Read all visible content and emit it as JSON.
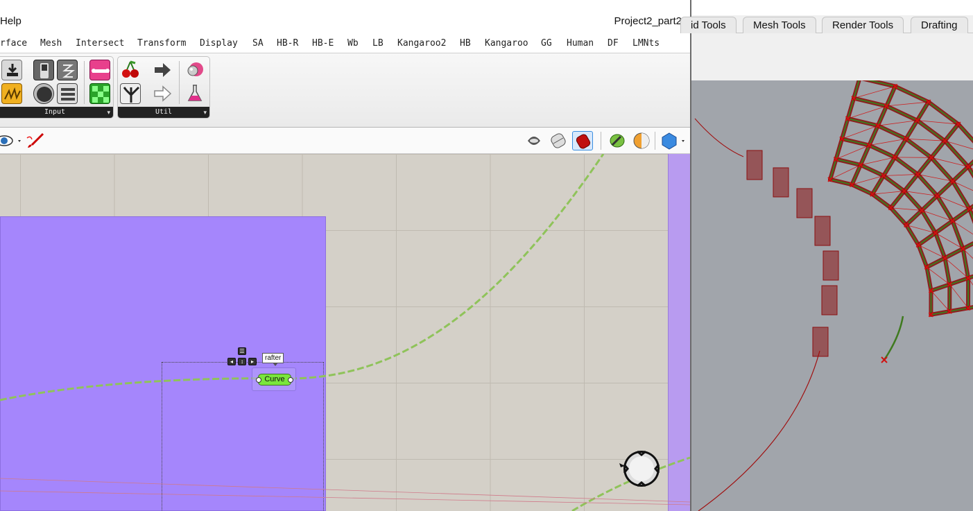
{
  "grasshopper": {
    "title": "Project2_part2",
    "menu_fragment": "Help",
    "tabs": [
      {
        "label": "rface"
      },
      {
        "label": "Mesh"
      },
      {
        "label": "Intersect"
      },
      {
        "label": "Transform"
      },
      {
        "label": "Display"
      },
      {
        "label": "SA"
      },
      {
        "label": "HB-R"
      },
      {
        "label": "HB-E"
      },
      {
        "label": "Wb"
      },
      {
        "label": "LB"
      },
      {
        "label": "Kangaroo2"
      },
      {
        "label": "HB"
      },
      {
        "label": "Kangaroo"
      },
      {
        "label": "GG"
      },
      {
        "label": "Human"
      },
      {
        "label": "DF"
      },
      {
        "label": "LMNts"
      }
    ],
    "panels": {
      "input": {
        "label": "Input",
        "arrow": "▾"
      },
      "util": {
        "label": "Util",
        "arrow": "▾"
      }
    },
    "canvas": {
      "component_label": "Curve",
      "component_nickname": "rafter",
      "menu_glyph": "☰",
      "nav_left": "◂",
      "nav_center": "↕",
      "nav_right": "▸"
    }
  },
  "rhino": {
    "tabs": [
      {
        "label": "id Tools"
      },
      {
        "label": "Mesh Tools"
      },
      {
        "label": "Render Tools"
      },
      {
        "label": "Drafting"
      }
    ]
  },
  "colors": {
    "canvas_bg": "#d4d0c8",
    "group_purple": "#a586fc",
    "component_green": "#7ae53c",
    "wire_green": "#8fc35a",
    "viewport_bg": "#a1a5ab",
    "structure_red": "#8b1010",
    "structure_green": "#3f7a1f"
  },
  "icons": [
    "eye-icon",
    "sketch-brush-icon",
    "preview-shaded-icon",
    "preview-wire-icon",
    "preview-selected-icon",
    "bake-icon",
    "material-sphere-icon",
    "display-mesh-icon",
    "cherry-icon",
    "tree-icon",
    "arrow-right-icon",
    "arrow-outline-icon",
    "bubble-icon",
    "flask-icon"
  ]
}
